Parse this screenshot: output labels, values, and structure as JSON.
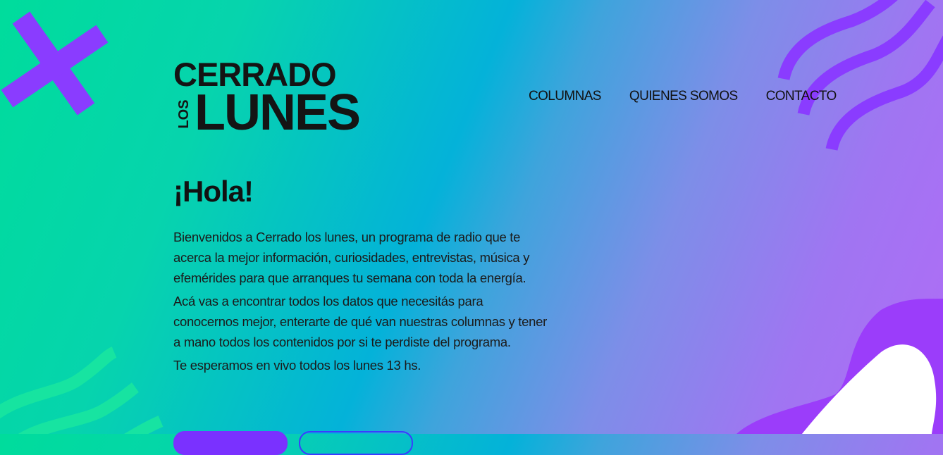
{
  "logo": {
    "line1": "CERRADO",
    "side": "LOS",
    "line2": "LUNES"
  },
  "nav": {
    "items": [
      "COLUMNAS",
      "QUIENES SOMOS",
      "CONTACTO"
    ]
  },
  "hero": {
    "title": "¡Hola!",
    "paragraphs": [
      "Bienvenidos a Cerrado los lunes, un programa de radio que te acerca la mejor información, curiosidades, entrevistas, música y efemérides para que arranques tu semana con toda la energía.",
      "Acá vas a encontrar todos los datos que necesitás para conocernos mejor, enterarte de qué van nuestras columnas y tener a mano todos los contenidos por si te perdiste del programa.",
      "Te esperamos en vivo todos los lunes 13 hs."
    ]
  },
  "colors": {
    "purple": "#8a3cff",
    "mint": "#19e6a0",
    "blob": "#9b3dfa",
    "white": "#ffffff"
  },
  "icons": [
    "x-shape-decoration",
    "wavy-lines-decoration",
    "blob-decoration"
  ]
}
